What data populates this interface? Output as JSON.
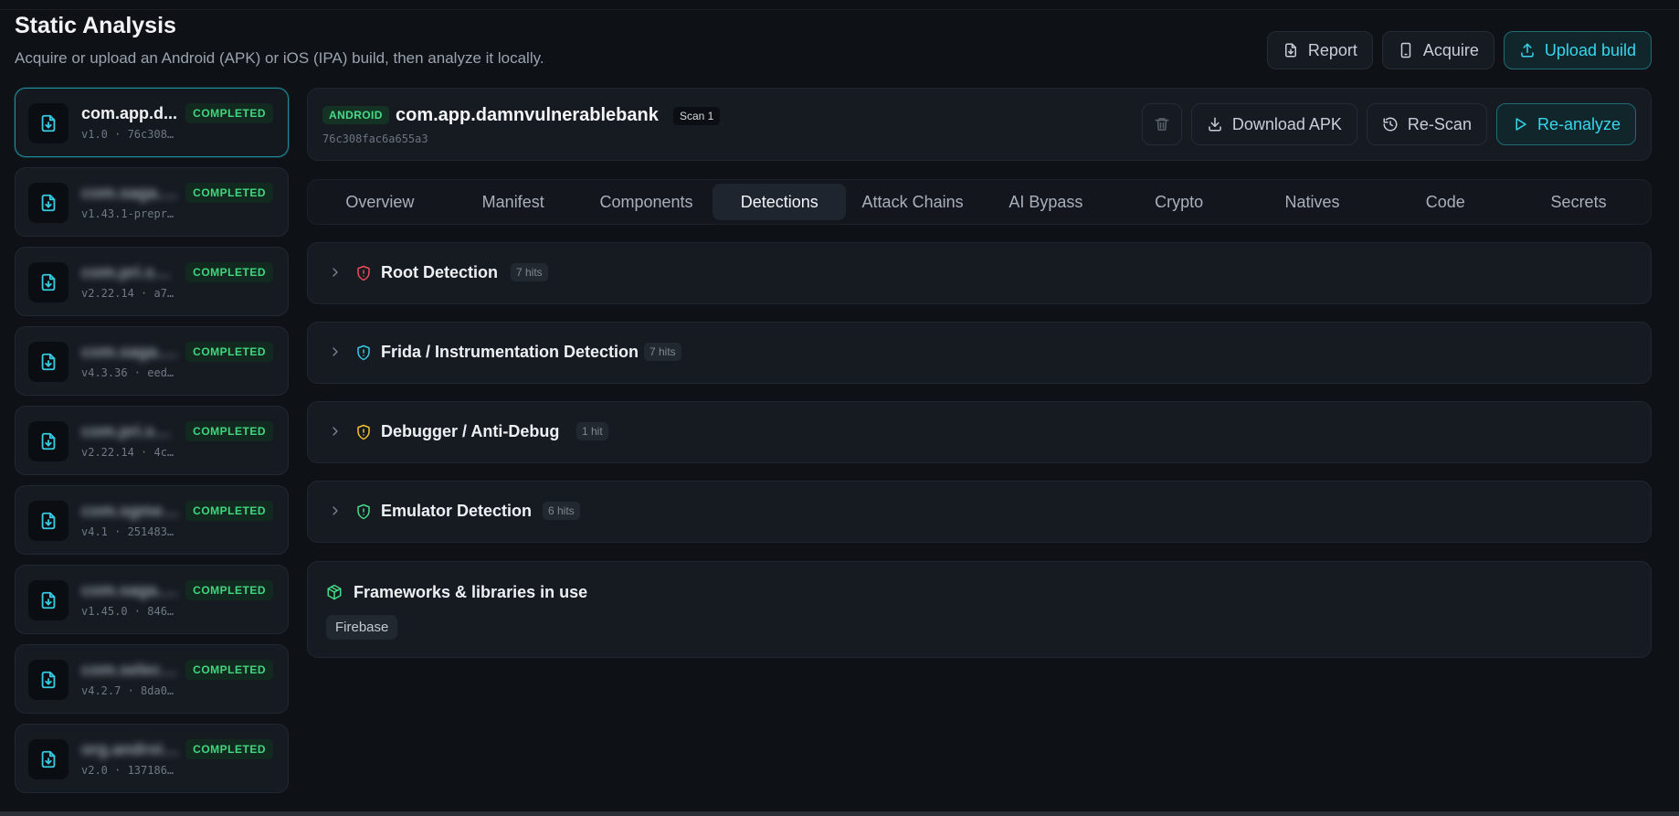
{
  "header": {
    "title": "Static Analysis",
    "subtitle": "Acquire or upload an Android (APK) or iOS (IPA) build, then analyze it locally.",
    "actions": {
      "report": "Report",
      "acquire": "Acquire",
      "upload": "Upload build"
    }
  },
  "builds": [
    {
      "name": "com.app.d...",
      "meta": "v1.0 · 76c308…",
      "status": "COMPLETED"
    },
    {
      "name": "com.saga.r…",
      "meta": "v1.43.1-prepr…",
      "status": "COMPLETED"
    },
    {
      "name": "com.pri.sp…",
      "meta": "v2.22.14 · a7…",
      "status": "COMPLETED"
    },
    {
      "name": "com.saga.…",
      "meta": "v4.3.36 · eed…",
      "status": "COMPLETED"
    },
    {
      "name": "com.pri.sp…",
      "meta": "v2.22.14 · 4c…",
      "status": "COMPLETED"
    },
    {
      "name": "com.sgmen…",
      "meta": "v4.1 · 251483…",
      "status": "COMPLETED"
    },
    {
      "name": "com.saga.h…",
      "meta": "v1.45.0 · 846…",
      "status": "COMPLETED"
    },
    {
      "name": "com.select…",
      "meta": "v4.2.7 · 8da0…",
      "status": "COMPLETED"
    },
    {
      "name": "org.androi…",
      "meta": "v2.0 · 137186…",
      "status": "COMPLETED"
    }
  ],
  "app": {
    "platform": "ANDROID",
    "package": "com.app.damnvulnerablebank",
    "scan": "Scan 1",
    "hash": "76c308fac6a655a3",
    "actions": {
      "download": "Download APK",
      "rescan": "Re-Scan",
      "reanalyze": "Re-analyze"
    }
  },
  "tabs": [
    "Overview",
    "Manifest",
    "Components",
    "Detections",
    "Attack Chains",
    "AI Bypass",
    "Crypto",
    "Natives",
    "Code",
    "Secrets"
  ],
  "active_tab": "Detections",
  "detections": [
    {
      "title": "Root Detection",
      "hits": "7 hits",
      "color": "#ef4a5a"
    },
    {
      "title": "Frida / Instrumentation Detection",
      "hits": "7 hits",
      "color": "#36cbe2"
    },
    {
      "title": "Debugger / Anti-Debug",
      "hits": "1 hit",
      "color": "#f2c230"
    },
    {
      "title": "Emulator Detection",
      "hits": "6 hits",
      "color": "#46db86"
    }
  ],
  "frameworks": {
    "title": "Frameworks & libraries in use",
    "items": [
      "Firebase"
    ]
  },
  "colors": {
    "accent": "#36cbe2",
    "success": "#3fd77f",
    "background": "#0e1116"
  }
}
